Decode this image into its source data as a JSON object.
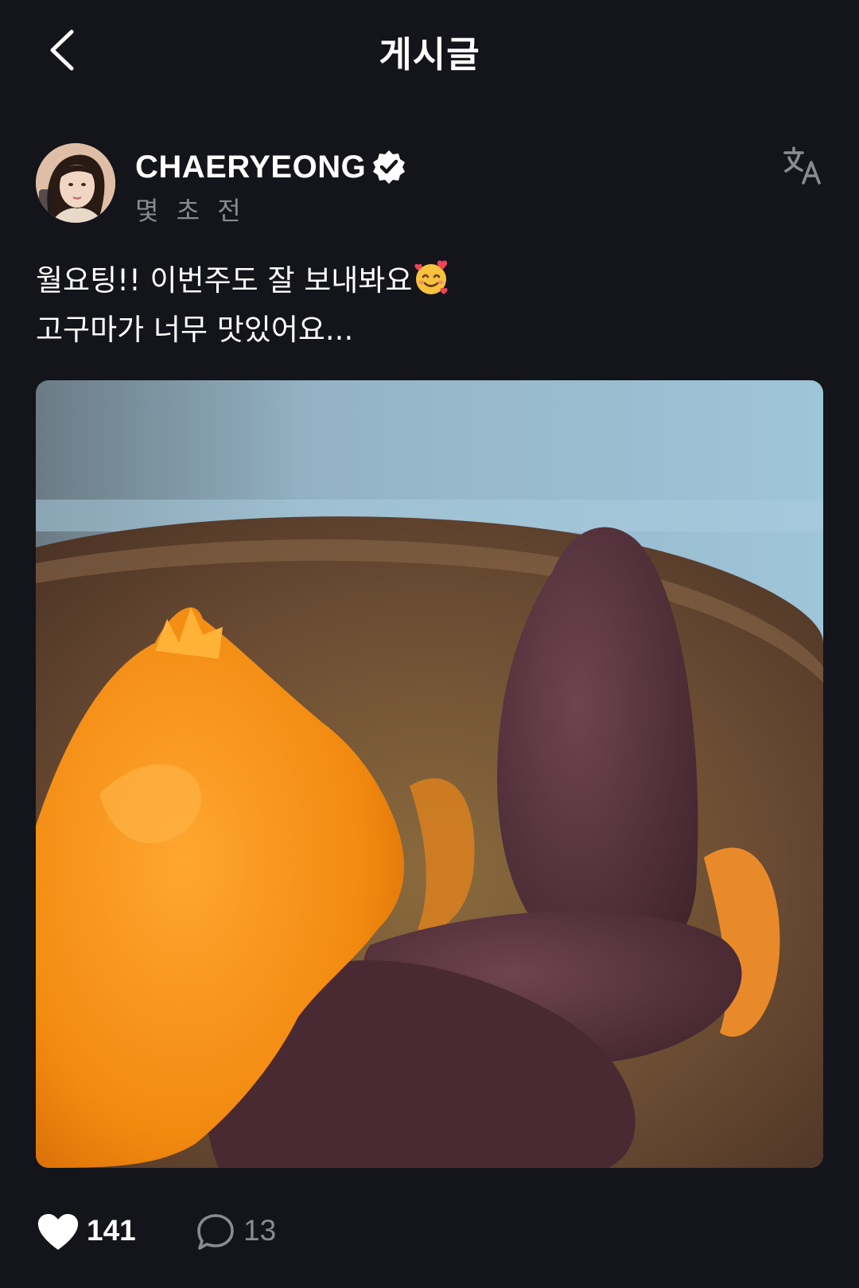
{
  "header": {
    "title": "게시글",
    "back_icon": "chevron-left-icon"
  },
  "author": {
    "name": "CHAERYEONG",
    "verified": true,
    "timestamp": "몇 초 전",
    "translate_icon": "translate-icon"
  },
  "post": {
    "text_line_1": "월요팅!! 이번주도 잘 보내봐요",
    "text_line_1_emoji": "smiling-face-with-hearts",
    "text_line_2": "고구마가 너무 맛있어요...",
    "photo_subject": "sweet-potatoes-in-wooden-bowl"
  },
  "actions": {
    "like_count": "141",
    "comment_count": "13",
    "like_icon": "heart-icon",
    "comment_icon": "comment-bubble-icon"
  },
  "colors": {
    "background": "#14141b",
    "text_primary": "#ffffff",
    "text_secondary": "#8a8a93"
  }
}
